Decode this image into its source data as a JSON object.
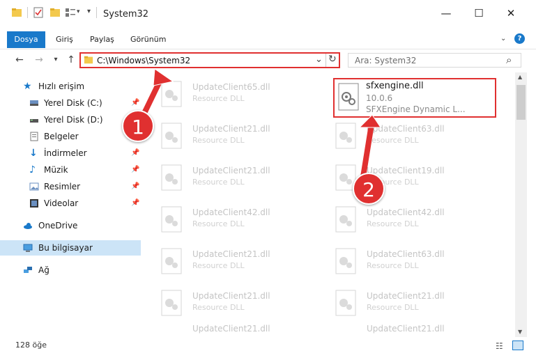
{
  "window": {
    "title": "System32",
    "minimize_glyph": "—",
    "maximize_glyph": "☐",
    "close_glyph": "✕"
  },
  "ribbon": {
    "tabs": [
      "Dosya",
      "Giriş",
      "Paylaş",
      "Görünüm"
    ],
    "help_glyph": "?"
  },
  "nav": {
    "address": "C:\\Windows\\System32",
    "search_placeholder": "Ara: System32",
    "back_glyph": "←",
    "forward_glyph": "→",
    "recent_glyph": "▾",
    "up_glyph": "↑",
    "dropdown_glyph": "⌄",
    "refresh_glyph": "↻",
    "search_glyph": "⌕"
  },
  "sidebar": {
    "items": [
      {
        "label": "Hızlı erişim",
        "icon": "star-icon",
        "pinned": false
      },
      {
        "label": "Yerel Disk (C:)",
        "icon": "drive-icon",
        "pinned": true
      },
      {
        "label": "Yerel Disk (D:)",
        "icon": "drive-icon",
        "pinned": true
      },
      {
        "label": "Belgeler",
        "icon": "document-icon",
        "pinned": true
      },
      {
        "label": "İndirmeler",
        "icon": "download-icon",
        "pinned": true
      },
      {
        "label": "Müzik",
        "icon": "music-icon",
        "pinned": true
      },
      {
        "label": "Resimler",
        "icon": "pictures-icon",
        "pinned": true
      },
      {
        "label": "Videolar",
        "icon": "video-icon",
        "pinned": true
      },
      {
        "label": "OneDrive",
        "icon": "cloud-icon",
        "pinned": false
      },
      {
        "label": "Bu bilgisayar",
        "icon": "computer-icon",
        "pinned": false
      },
      {
        "label": "Ağ",
        "icon": "network-icon",
        "pinned": false
      }
    ]
  },
  "files_left": [
    {
      "name": "UpdateClient65.dll",
      "desc": "Resource DLL"
    },
    {
      "name": "UpdateClient21.dll",
      "desc": "Resource DLL"
    },
    {
      "name": "UpdateClient21.dll",
      "desc": "Resource DLL"
    },
    {
      "name": "UpdateClient42.dll",
      "desc": "Resource DLL"
    },
    {
      "name": "UpdateClient21.dll",
      "desc": "Resource DLL"
    },
    {
      "name": "UpdateClient21.dll",
      "desc": "Resource DLL"
    },
    {
      "name": "UpdateClient21.dll",
      "desc": "Resource DLL"
    }
  ],
  "files_right": [
    {
      "name": "UpdateClient63.dll",
      "desc": "Resource DLL"
    },
    {
      "name": "UpdateClient19.dll",
      "desc": "Resource DLL"
    },
    {
      "name": "UpdateClient42.dll",
      "desc": "Resource DLL"
    },
    {
      "name": "UpdateClient63.dll",
      "desc": "Resource DLL"
    },
    {
      "name": "UpdateClient21.dll",
      "desc": "Resource DLL"
    },
    {
      "name": "UpdateClient21.dll",
      "desc": "Resource DLL"
    }
  ],
  "selected_file": {
    "name": "sfxengine.dll",
    "version": "10.0.6",
    "description": "SFXEngine Dynamic L..."
  },
  "status": {
    "count": "128 öğe"
  },
  "annotations": [
    "1",
    "2"
  ],
  "colors": {
    "accent": "#1979ca",
    "highlight": "#e03030"
  }
}
